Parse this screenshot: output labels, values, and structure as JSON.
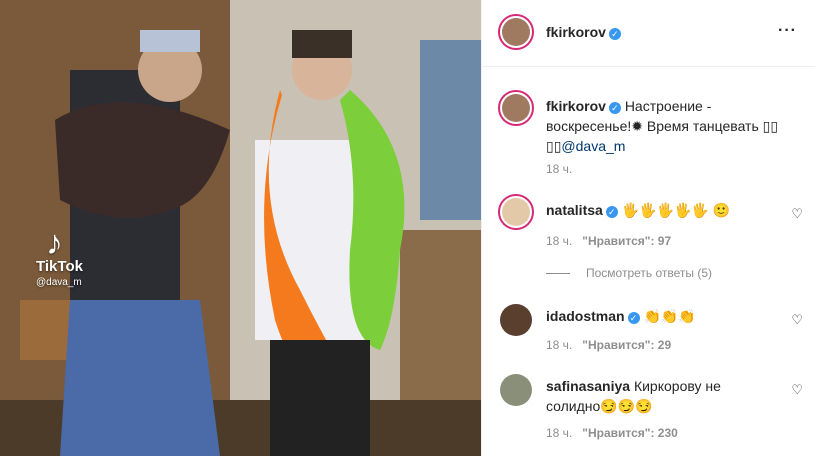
{
  "colors": {
    "verified": "#3897f0",
    "ring": "#d62976",
    "mention": "#00376b",
    "muted": "#8e8e8e"
  },
  "media": {
    "watermark_logo": "♪",
    "watermark_brand": "TikTok",
    "watermark_user": "@dava_m"
  },
  "header": {
    "username": "fkirkorov",
    "more_icon": "more-dots-icon"
  },
  "caption": {
    "username": "fkirkorov",
    "text": "Настроение - воскресенье!✹ Время танцевать ▯▯ ▯▯",
    "mention": "@dava_m",
    "time": "18 ч."
  },
  "comments": [
    {
      "username": "natalitsa",
      "text": "🖐🖐🖐🖐🖐 🙂",
      "time": "18 ч.",
      "likes": "\"Нравится\": 97"
    },
    {
      "username": "idadostman",
      "text": "👏👏👏",
      "time": "18 ч.",
      "likes": "\"Нравится\": 29"
    },
    {
      "username": "safinasaniya",
      "text": "Киркорову не солидно😏😏😏",
      "time": "18 ч.",
      "likes": "\"Нравится\": 230"
    }
  ],
  "replies_label": "Посмотреть ответы (5)"
}
